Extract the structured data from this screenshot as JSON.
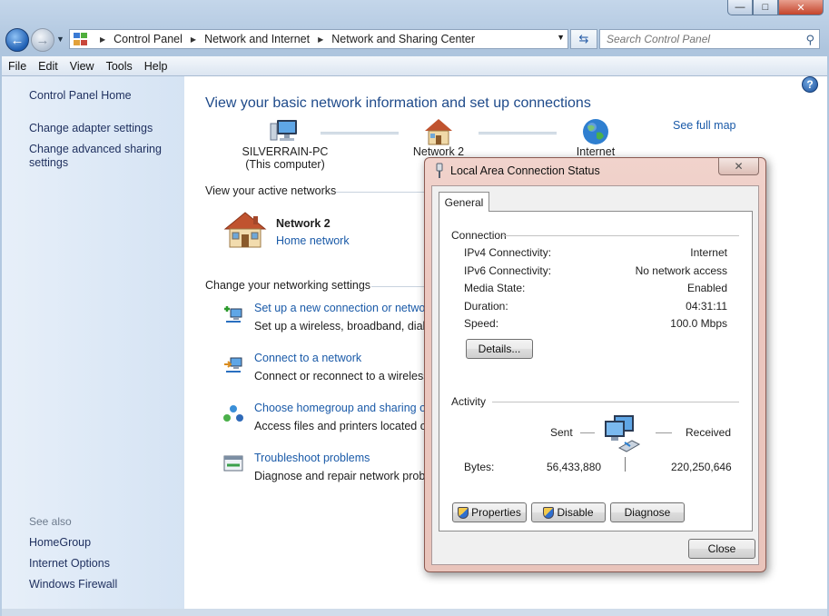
{
  "window": {
    "minimize_glyph": "—",
    "maximize_glyph": "□",
    "close_glyph": "✕"
  },
  "address": {
    "crumbs": [
      "Control Panel",
      "Network and Internet",
      "Network and Sharing Center"
    ],
    "search_placeholder": "Search Control Panel"
  },
  "menu": [
    "File",
    "Edit",
    "View",
    "Tools",
    "Help"
  ],
  "sidebar": {
    "home": "Control Panel Home",
    "adapter": "Change adapter settings",
    "sharing_line1": "Change advanced sharing",
    "sharing_line2": "settings",
    "see_also": "See also",
    "homegroup": "HomeGroup",
    "internet_options": "Internet Options",
    "firewall": "Windows Firewall"
  },
  "main": {
    "title": "View your basic network information and set up connections",
    "see_full_map": "See full map",
    "map": {
      "computer_name": "SILVERRAIN-PC",
      "computer_sub": "(This computer)",
      "network": "Network 2",
      "internet": "Internet"
    },
    "active_networks_header": "View your active networks",
    "network_name": "Network  2",
    "network_type": "Home network",
    "settings_header": "Change your networking settings",
    "tasks": [
      {
        "link": "Set up a new connection or network",
        "desc": "Set up a wireless, broadband, dial-up, ad hoc, or VPN connection"
      },
      {
        "link": "Connect to a network",
        "desc": "Connect or reconnect to a wireless, wired, dial-up, or VPN connection"
      },
      {
        "link": "Choose homegroup and sharing options",
        "desc": "Access files and printers located on other network computers"
      },
      {
        "link": "Troubleshoot problems",
        "desc": "Diagnose and repair network problems"
      }
    ]
  },
  "dialog": {
    "title": "Local Area Connection Status",
    "tab": "General",
    "connection_header": "Connection",
    "rows": [
      {
        "label": "IPv4 Connectivity:",
        "value": "Internet"
      },
      {
        "label": "IPv6 Connectivity:",
        "value": "No network access"
      },
      {
        "label": "Media State:",
        "value": "Enabled"
      },
      {
        "label": "Duration:",
        "value": "04:31:11"
      },
      {
        "label": "Speed:",
        "value": "100.0 Mbps"
      }
    ],
    "details_button": "Details...",
    "activity_header": "Activity",
    "sent_label": "Sent",
    "received_label": "Received",
    "bytes_label": "Bytes:",
    "bytes_sent": "56,433,880",
    "bytes_received": "220,250,646",
    "properties_button": "Properties",
    "disable_button": "Disable",
    "diagnose_button": "Diagnose",
    "close_button": "Close"
  }
}
